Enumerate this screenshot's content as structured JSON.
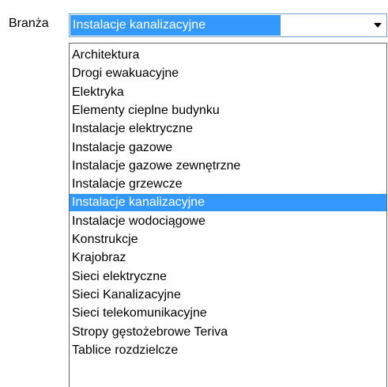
{
  "field": {
    "label": "Branża",
    "selected_value": "Instalacje kanalizacyjne"
  },
  "dropdown": {
    "selected_index": 8,
    "items": [
      "Architektura",
      "Drogi ewakuacyjne",
      "Elektryka",
      "Elementy cieplne budynku",
      "Instalacje elektryczne",
      "Instalacje gazowe",
      "Instalacje gazowe zewnętrzne",
      "Instalacje grzewcze",
      "Instalacje kanalizacyjne",
      "Instalacje wodociągowe",
      "Konstrukcje",
      "Krajobraz",
      "Sieci elektryczne",
      "Sieci Kanalizacyjne",
      "Sieci telekomunikacyjne",
      "Stropy gęstożebrowe Teriva",
      "Tablice rozdzielcze"
    ]
  },
  "colors": {
    "selection": "#3399ff",
    "combo_border": "#7a9fc7",
    "list_border": "#646464"
  }
}
